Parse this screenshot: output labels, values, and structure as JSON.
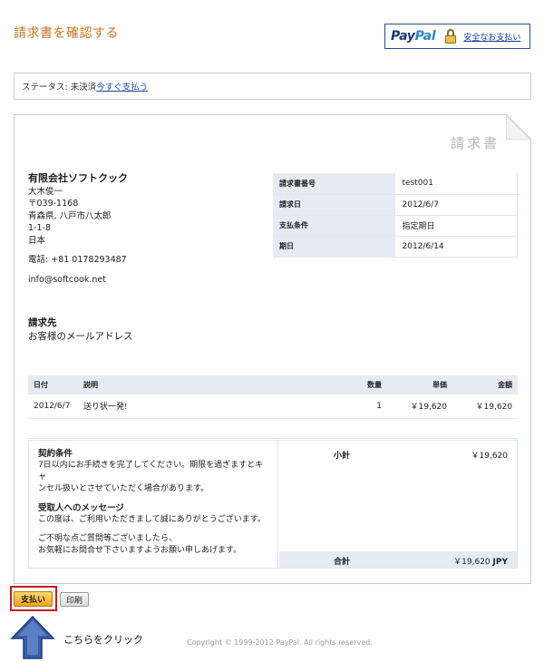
{
  "header": {
    "title": "請求書を確認する",
    "paypal_logo_text_1": "Pay",
    "paypal_logo_text_2": "Pal",
    "secure_payment_link": "安全なお支払い"
  },
  "status": {
    "label": "ステータス: 未決済",
    "pay_now_link": "今すぐ支払う"
  },
  "invoice": {
    "heading": "請求書",
    "seller": {
      "company": "有限会社ソフトクック",
      "contact": "大木俊一",
      "postal": "〒039-1168",
      "address1": "青森県, 八戸市八太郎",
      "address2": "1-1-8",
      "country": "日本",
      "phone": "電話: +81 0178293487",
      "email": "info@softcook.net"
    },
    "meta": [
      {
        "label": "請求書番号",
        "value": "test001"
      },
      {
        "label": "請求日",
        "value": "2012/6/7"
      },
      {
        "label": "支払条件",
        "value": "指定期日"
      },
      {
        "label": "期日",
        "value": "2012/6/14"
      }
    ],
    "bill_to": {
      "label": "請求先",
      "value": "お客様のメールアドレス"
    },
    "items_header": {
      "date": "日付",
      "description": "説明",
      "quantity": "数量",
      "unit_price": "単価",
      "amount": "金額"
    },
    "items": [
      {
        "date": "2012/6/7",
        "description": "送り状一発!",
        "quantity": "1",
        "unit_price": "￥19,620",
        "amount": "￥19,620"
      }
    ],
    "terms": {
      "terms_label": "契約条件",
      "terms_line1": "7日以内にお手続きを完了してください。期限を過ぎますとキャ",
      "terms_line2": "ンセル扱いとさせていただく場合があります。",
      "message_label": "受取人へのメッセージ",
      "message_line1": "この度は、ご利用いただきまして誠にありがとうございます。",
      "message_line2": "ご不明な点ご質問等ございましたら、",
      "message_line3": "お気軽にお問合せ下さいますようお願い申しあげます。"
    },
    "subtotal_label": "小計",
    "subtotal_value": "￥19,620",
    "total_label": "合計",
    "total_value": "￥19,620",
    "total_currency": "JPY"
  },
  "actions": {
    "pay_button": "支払い",
    "print_button": "印刷"
  },
  "annotation": {
    "click_note": "こちらをクリック"
  },
  "footer": {
    "copyright": "Copyright © 1999-2012 PayPal. All rights reserved."
  },
  "colors": {
    "title_orange": "#c8741f",
    "table_header_blue": "#e6ebf3",
    "highlight_red": "#c51d1d",
    "arrow_blue": "#3a5fa8"
  }
}
